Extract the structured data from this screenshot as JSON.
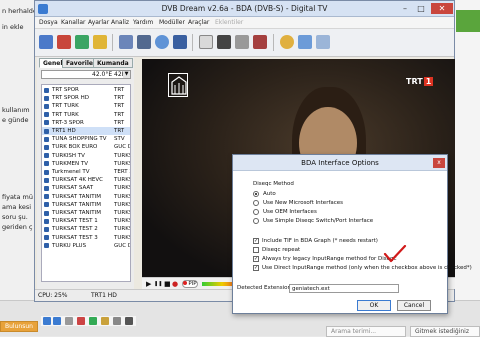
{
  "background_page": {
    "snippets_left": [
      "n herhalde.",
      "in ekle",
      "kullanım",
      "e günde",
      "fiyata mü",
      "ama kesi",
      "soru şu.",
      "geriden ç"
    ],
    "bottom_left_chip": "Bulunsun",
    "search_placeholder": "Arama terimi...",
    "bottom_right_text": "Gitmek istediğiniz"
  },
  "window": {
    "title": "DVB Dream v2.6a - BDA (DVB-S) - Digital TV",
    "minimize": "–",
    "maximize": "□",
    "close": "✕"
  },
  "menu": {
    "items": [
      "Dosya",
      "Kanallar",
      "Ayarlar",
      "Analiz",
      "Yardım",
      "Modüller",
      "Araçlar",
      "Eklentiler"
    ]
  },
  "panel": {
    "tabs": [
      "Genel",
      "Favoriler",
      "Kumanda"
    ],
    "satellite": "42.0°E 42E",
    "satellite_drop": "▼",
    "channels": [
      {
        "name": "TRT SPOR",
        "provider": "TRT"
      },
      {
        "name": "TRT SPOR HD",
        "provider": "TRT"
      },
      {
        "name": "TRT TURK",
        "provider": "TRT"
      },
      {
        "name": "TRT TURK",
        "provider": "TRT"
      },
      {
        "name": "TRT-3 SPOR",
        "provider": "TRT"
      },
      {
        "name": "TRT1 HD",
        "provider": "TRT"
      },
      {
        "name": "TUNA SHOPPING TV",
        "provider": "STV"
      },
      {
        "name": "TURK BOX EURO",
        "provider": "GUC D"
      },
      {
        "name": "TURKISH TV",
        "provider": "TURKS"
      },
      {
        "name": "TURKMEN TV",
        "provider": "TURKS"
      },
      {
        "name": "Turkmenel TV",
        "provider": "TERT 2"
      },
      {
        "name": "TURKSAT 4K HEVC",
        "provider": "TURKS"
      },
      {
        "name": "TURKSAT SAAT",
        "provider": "TURKS"
      },
      {
        "name": "TURKSAT TANITIM",
        "provider": "TURKS"
      },
      {
        "name": "TURKSAT TANITIM",
        "provider": "TURKS"
      },
      {
        "name": "TURKSAT TANITIM",
        "provider": "TURKS"
      },
      {
        "name": "TURKSAT TEST 1",
        "provider": "TURKS"
      },
      {
        "name": "TURKSAT TEST 2",
        "provider": "TURKS"
      },
      {
        "name": "TURKSAT TEST 3",
        "provider": "TURKS"
      },
      {
        "name": "TURKU PLUS",
        "provider": "GUC D"
      }
    ],
    "selected_index": 5
  },
  "video": {
    "channel_logo": "TRT",
    "channel_number": "1"
  },
  "playback": {
    "play": "▶",
    "pause": "❚❚",
    "stop": "■",
    "rec": "●",
    "pip": "PIP"
  },
  "status": {
    "cpu": "CPU: 25%",
    "channel": "TRT1 HD"
  },
  "dialog": {
    "title": "BDA Interface Options",
    "close": "x",
    "diseqc_label": "Diseqc Method",
    "options": [
      "Auto",
      "Use New Microsoft Interfaces",
      "Use OEM Interfaces",
      "Use Simple Diseqc Switch/Port Interface"
    ],
    "selected_option": 0,
    "checkboxes": [
      {
        "label": "Include TIF in BDA Graph (* needs restart)",
        "checked": true
      },
      {
        "label": "Diseqc repeat",
        "checked": false
      },
      {
        "label": "Always try legacy InputRange method for Diseqc",
        "checked": true
      },
      {
        "label": "Use Direct InputRange method (only when the checkbox above is checked*)",
        "checked": true
      }
    ],
    "extension_label": "Detected Extension:",
    "extension_value": "geniatech.ext",
    "ok": "OK",
    "cancel": "Cancel"
  },
  "colors": {
    "accent": "#3b7bd1",
    "close_red": "#c9463d",
    "check_mark": "#d11a1a",
    "list_selection": "#cfe0f7"
  }
}
